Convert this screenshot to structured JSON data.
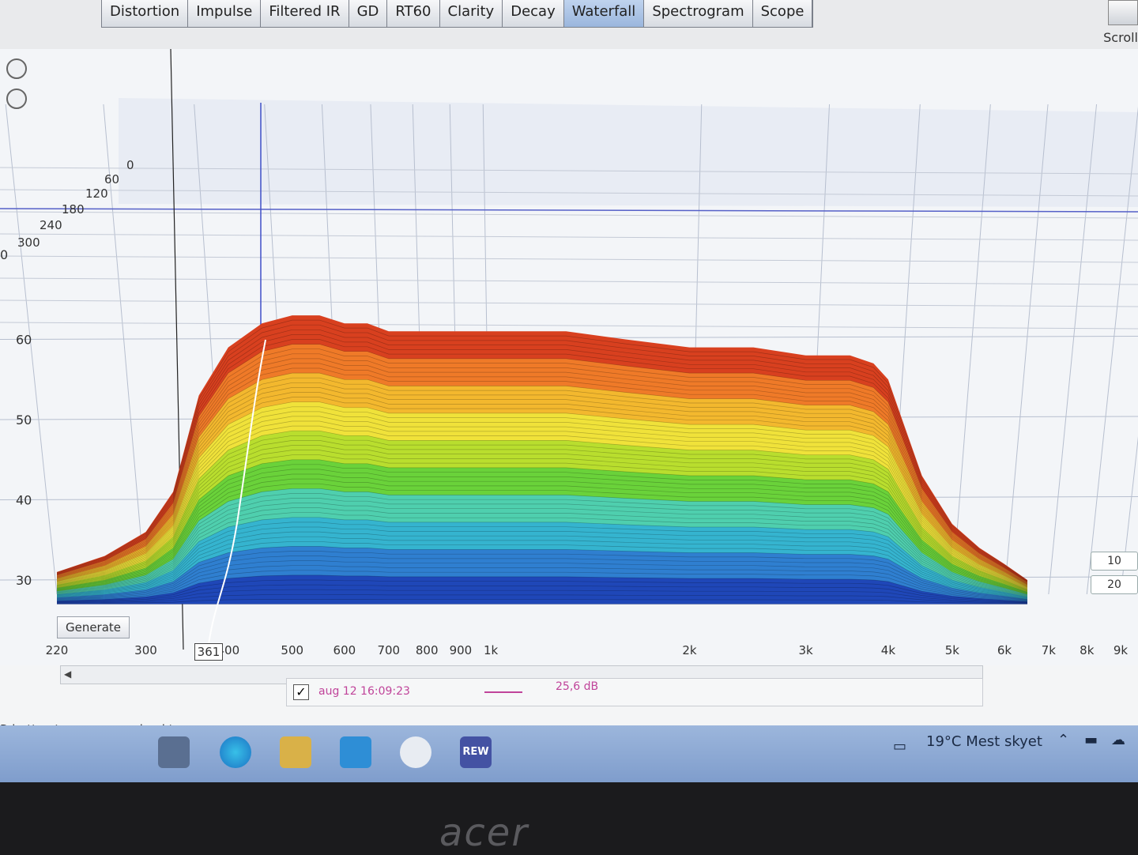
{
  "tabs": [
    "Distortion",
    "Impulse",
    "Filtered IR",
    "GD",
    "RT60",
    "Clarity",
    "Decay",
    "Waterfall",
    "Spectrogram",
    "Scope"
  ],
  "active_tab": "Waterfall",
  "scroll_label": "Scroll",
  "chart_data": {
    "type": "area",
    "subtype": "waterfall-3d",
    "x_scale": "log",
    "x_tick_labels": [
      "220",
      "300",
      "400",
      "500",
      "600",
      "700",
      "800",
      "900",
      "1k",
      "2k",
      "3k",
      "4k",
      "5k",
      "6k",
      "7k",
      "8k",
      "9k"
    ],
    "x_ticks": [
      220,
      300,
      400,
      500,
      600,
      700,
      800,
      900,
      1000,
      2000,
      3000,
      4000,
      5000,
      6000,
      7000,
      8000,
      9000
    ],
    "y_tick_labels": [
      "30",
      "40",
      "50",
      "60",
      "0"
    ],
    "z_tick_labels": [
      "0",
      "60",
      "120",
      "180",
      "240",
      "300"
    ],
    "cursor_x": "361",
    "right_labels": [
      "10",
      "20"
    ],
    "colors": [
      "#1f47b8",
      "#2f7fd0",
      "#35b4cf",
      "#4fcfae",
      "#6ad23a",
      "#b9de2e",
      "#f0e23a",
      "#f3b82e",
      "#ef7a28",
      "#d8401f"
    ],
    "surface_profile_x": [
      220,
      260,
      300,
      330,
      361,
      400,
      450,
      500,
      550,
      600,
      650,
      700,
      800,
      900,
      1000,
      1300,
      1600,
      2000,
      2500,
      3000,
      3500,
      3800,
      4000,
      4200,
      4500,
      5000,
      5500,
      6000,
      6500
    ],
    "surface_profile_y": [
      31,
      33,
      36,
      41,
      53,
      59,
      62,
      63,
      63,
      62,
      62,
      61,
      61,
      61,
      61,
      61,
      60,
      59,
      59,
      58,
      58,
      57,
      55,
      50,
      43,
      37,
      34,
      32,
      30
    ]
  },
  "generate_label": "Generate",
  "legend": {
    "checked": "✓",
    "label": "aug 12 16:09:23",
    "level": "25,6 dB"
  },
  "status_text": "R button to measure; wheel to zoom;",
  "taskbar": {
    "weather": "19°C  Mest skyet",
    "app": "REW"
  },
  "bezel_brand": "acer"
}
